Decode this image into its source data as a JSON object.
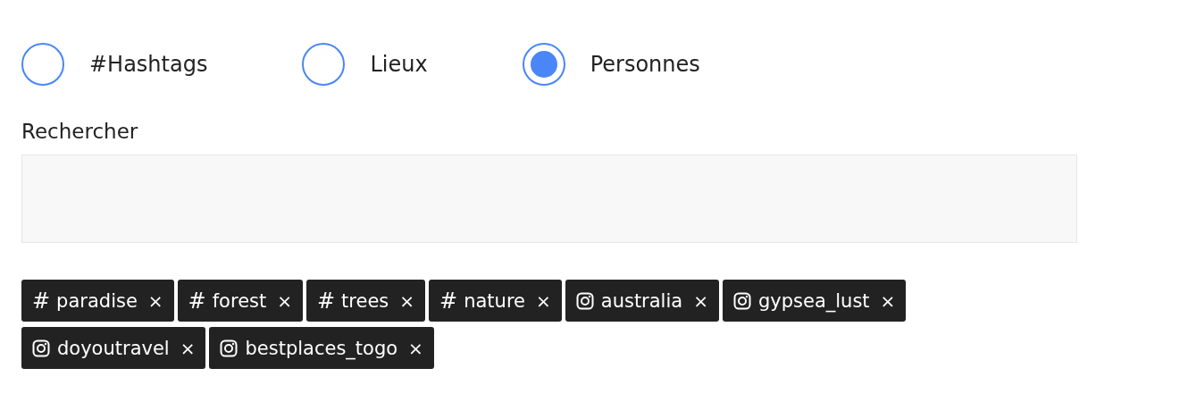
{
  "filter_options": [
    {
      "label": "#Hashtags",
      "selected": false
    },
    {
      "label": "Lieux",
      "selected": false
    },
    {
      "label": "Personnes",
      "selected": true
    }
  ],
  "search": {
    "label": "Rechercher"
  },
  "tags": [
    {
      "kind": "hashtag",
      "prefix": "#",
      "text": "paradise",
      "remove": "×"
    },
    {
      "kind": "hashtag",
      "prefix": "#",
      "text": "forest",
      "remove": "×"
    },
    {
      "kind": "hashtag",
      "prefix": "#",
      "text": "trees",
      "remove": "×"
    },
    {
      "kind": "hashtag",
      "prefix": "#",
      "text": "nature",
      "remove": "×"
    },
    {
      "kind": "instagram",
      "text": "australia",
      "remove": "×"
    },
    {
      "kind": "instagram",
      "text": "gypsea_lust",
      "remove": "×"
    },
    {
      "kind": "instagram",
      "text": "doyoutravel",
      "remove": "×"
    },
    {
      "kind": "instagram",
      "text": "bestplaces_togo",
      "remove": "×"
    }
  ]
}
